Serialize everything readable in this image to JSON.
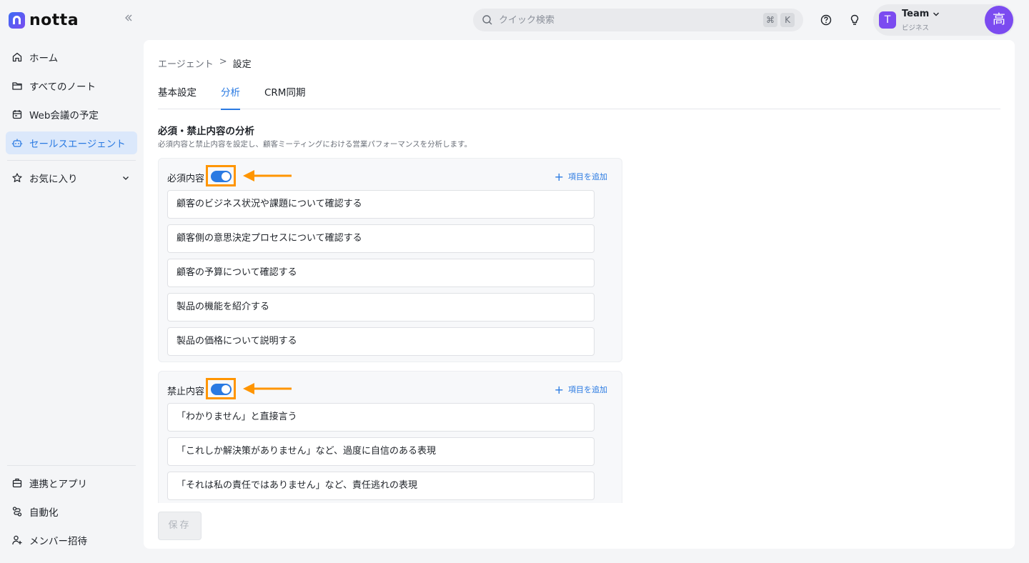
{
  "app": {
    "logo_text": "notta",
    "brand_color": "#2a7ae2",
    "accent_purple": "#7b4bf0",
    "highlight_color": "#ff9500"
  },
  "sidebar": {
    "items": [
      {
        "label": "ホーム",
        "icon": "home-icon"
      },
      {
        "label": "すべてのノート",
        "icon": "folder-icon"
      },
      {
        "label": "Web会議の予定",
        "icon": "calendar-icon"
      },
      {
        "label": "セールスエージェント",
        "icon": "robot-icon",
        "active": true
      },
      {
        "label": "お気に入り",
        "icon": "star-icon"
      }
    ],
    "bottom_items": [
      {
        "label": "連携とアプリ",
        "icon": "briefcase-icon"
      },
      {
        "label": "自動化",
        "icon": "automation-icon"
      },
      {
        "label": "メンバー招待",
        "icon": "add-user-icon"
      }
    ]
  },
  "topbar": {
    "search_placeholder": "クイック検索",
    "shortcut_keys": [
      "⌘",
      "K"
    ],
    "account": {
      "avatar_letter": "T",
      "name": "Team",
      "plan": "ビジネス"
    },
    "user_avatar": "高"
  },
  "main": {
    "breadcrumb": {
      "parent": "エージェント",
      "separator": ">",
      "current": "設定"
    },
    "tabs": [
      {
        "label": "基本設定"
      },
      {
        "label": "分析",
        "active": true
      },
      {
        "label": "CRM同期"
      }
    ],
    "section_title": "必須・禁止内容の分析",
    "section_desc": "必須内容と禁止内容を設定し、顧客ミーティングにおける営業パフォーマンスを分析します。",
    "required": {
      "label": "必須内容",
      "enabled": true,
      "add_label": "項目を追加",
      "items": [
        "顧客のビジネス状況や課題について確認する",
        "顧客側の意思決定プロセスについて確認する",
        "顧客の予算について確認する",
        "製品の機能を紹介する",
        "製品の価格について説明する"
      ]
    },
    "prohibited": {
      "label": "禁止内容",
      "enabled": true,
      "add_label": "項目を追加",
      "items": [
        "「わかりません」と直接言う",
        "「これしか解決策がありません」など、過度に自信のある表現",
        "「それは私の責任ではありません」など、責任逃れの表現"
      ]
    },
    "save_label": "保存"
  }
}
